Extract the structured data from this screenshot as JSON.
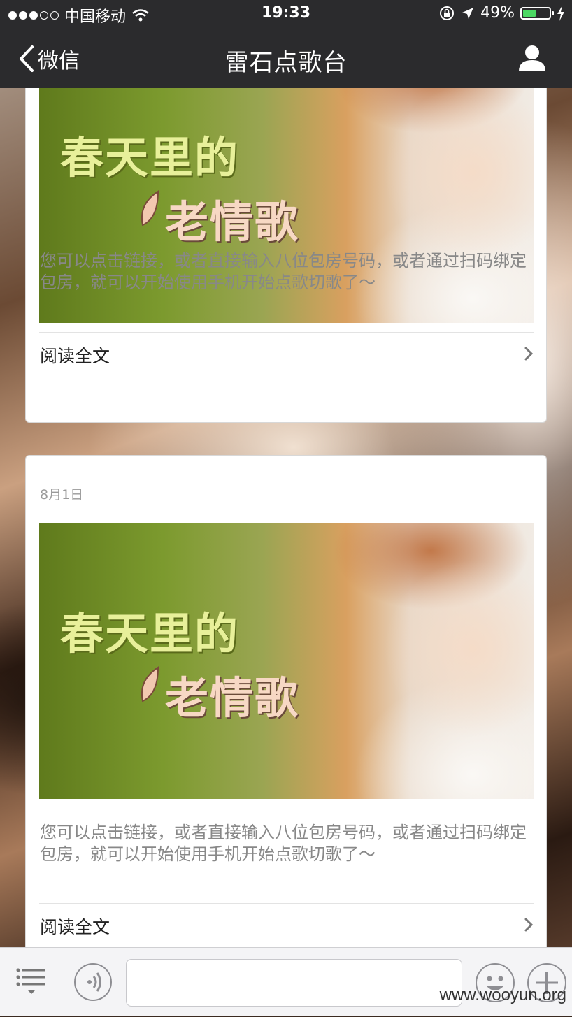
{
  "status_bar": {
    "carrier": "中国移动",
    "time": "19:33",
    "battery": "49%",
    "battery_level": 0.49,
    "signal_bars_on": 3,
    "signal_bars_total": 5
  },
  "nav": {
    "back_label": "微信",
    "title": "雷石点歌台"
  },
  "cards": [
    {
      "date": "",
      "image_text_line1": "春天里的",
      "image_text_line2": "老情歌",
      "description": "您可以点击链接，或者直接输入八位包房号码，或者通过扫码绑定包房，就可以开始使用手机开始点歌切歌了～",
      "read_more": "阅读全文"
    },
    {
      "date": "8月1日",
      "image_text_line1": "春天里的",
      "image_text_line2": "老情歌",
      "description": "您可以点击链接，或者直接输入八位包房号码，或者通过扫码绑定包房，就可以开始使用手机开始点歌切歌了～",
      "read_more": "阅读全文"
    }
  ],
  "input_bar": {
    "placeholder": ""
  },
  "watermark": "www.wooyun.org",
  "colors": {
    "nav_bg": "#2b2b2d",
    "battery_fill": "#4cd964",
    "card_bg": "#ffffff",
    "desc_text": "#888888"
  },
  "icons": [
    "wifi-icon",
    "rotation-lock-icon",
    "location-arrow-icon",
    "charging-bolt-icon",
    "back-chevron-icon",
    "profile-icon",
    "chevron-right-icon",
    "menu-list-icon",
    "voice-icon",
    "emoji-icon",
    "plus-icon"
  ]
}
